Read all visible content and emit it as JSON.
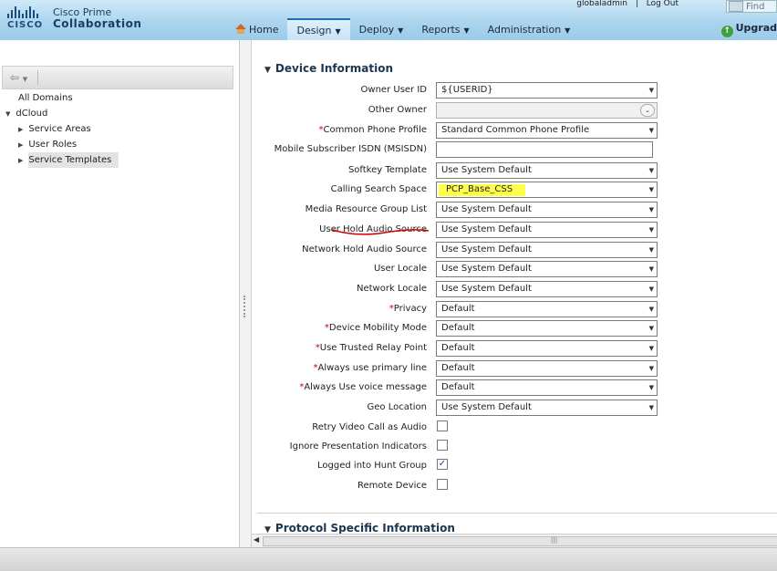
{
  "header": {
    "brand_line1": "Cisco Prime",
    "brand_line2": "Collaboration",
    "logo_word": "CISCO",
    "user": "globaladmin",
    "logout": "Log Out",
    "find": "Find",
    "upgrade": "Upgrad"
  },
  "nav": {
    "items": [
      {
        "label": "Home",
        "icon": "home-icon"
      },
      {
        "label": "Design",
        "active": true
      },
      {
        "label": "Deploy"
      },
      {
        "label": "Reports"
      },
      {
        "label": "Administration"
      }
    ]
  },
  "tree": {
    "all_domains": "All Domains",
    "root": "dCloud",
    "children": [
      "Service Areas",
      "User Roles",
      "Service Templates"
    ],
    "selected": "Service Templates"
  },
  "section": {
    "title": "Device Information",
    "next_title": "Protocol Specific Information"
  },
  "fields": [
    {
      "label": "Owner User ID",
      "required": false,
      "type": "select",
      "value": "${USERID}"
    },
    {
      "label": "Other Owner",
      "required": false,
      "type": "select-disabled",
      "value": ""
    },
    {
      "label": "Common Phone Profile",
      "required": true,
      "type": "select",
      "value": "Standard Common Phone Profile"
    },
    {
      "label": "Mobile Subscriber ISDN (MSISDN)",
      "required": false,
      "type": "text",
      "value": ""
    },
    {
      "label": "Softkey Template",
      "required": false,
      "type": "select",
      "value": "Use System Default"
    },
    {
      "label": "Calling Search Space",
      "required": false,
      "type": "select",
      "value": "PCP_Base_CSS",
      "highlight": true
    },
    {
      "label": "Media Resource Group List",
      "required": false,
      "type": "select",
      "value": "Use System Default"
    },
    {
      "label": "User Hold Audio Source",
      "required": false,
      "type": "select",
      "value": "Use System Default"
    },
    {
      "label": "Network Hold Audio Source",
      "required": false,
      "type": "select",
      "value": "Use System Default"
    },
    {
      "label": "User Locale",
      "required": false,
      "type": "select",
      "value": "Use System Default"
    },
    {
      "label": "Network Locale",
      "required": false,
      "type": "select",
      "value": "Use System Default"
    },
    {
      "label": "Privacy",
      "required": true,
      "type": "select",
      "value": "Default"
    },
    {
      "label": "Device Mobility Mode",
      "required": true,
      "type": "select",
      "value": "Default"
    },
    {
      "label": "Use Trusted Relay Point",
      "required": true,
      "type": "select",
      "value": "Default"
    },
    {
      "label": "Always use primary line",
      "required": true,
      "type": "select",
      "value": "Default"
    },
    {
      "label": "Always Use voice message",
      "required": true,
      "type": "select",
      "value": "Default"
    },
    {
      "label": "Geo Location",
      "required": false,
      "type": "select",
      "value": "Use System Default"
    },
    {
      "label": "Retry Video Call as Audio",
      "required": false,
      "type": "checkbox",
      "checked": false
    },
    {
      "label": "Ignore Presentation Indicators",
      "required": false,
      "type": "checkbox",
      "checked": false
    },
    {
      "label": "Logged into Hunt Group",
      "required": false,
      "type": "checkbox",
      "checked": true
    },
    {
      "label": "Remote Device",
      "required": false,
      "type": "checkbox",
      "checked": false
    }
  ],
  "colors": {
    "highlight": "#ffff4a",
    "required_star": "#cc0000",
    "annotation_underline": "#d40000"
  }
}
